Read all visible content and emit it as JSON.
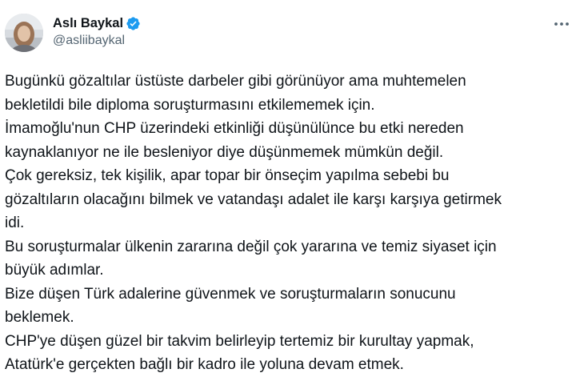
{
  "author": {
    "display_name": "Aslı Baykal",
    "handle": "@asliibaykal",
    "verified": true,
    "verified_color": "#1d9bf0"
  },
  "more_menu": {
    "icon": "more-horizontal-icon"
  },
  "tweet": {
    "lines": [
      "Bugünkü gözaltılar üstüste darbeler gibi görünüyor ama muhtemelen",
      "bekletildi bile diploma soruşturmasını etkilememek için.",
      "İmamoğlu'nun CHP üzerindeki etkinliği düşünülünce bu etki nereden",
      "kaynaklanıyor ne ile besleniyor diye düşünmemek mümkün değil.",
      "Çok gereksiz, tek kişilik, apar topar bir önseçim yapılma sebebi bu",
      "gözaltıların olacağını bilmek ve vatandaşı adalet ile karşı karşıya getirmek",
      "idi.",
      "Bu soruşturmalar ülkenin zararına değil çok yararına ve temiz siyaset için",
      "büyük adımlar.",
      "Bize düşen Türk adalerine güvenmek ve soruşturmaların sonucunu",
      "beklemek.",
      "CHP'ye düşen güzel bir takvim belirleyip tertemiz bir kurultay yapmak,",
      "Atatürk'e gerçekten bağlı bir kadro ile yoluna devam etmek."
    ]
  }
}
